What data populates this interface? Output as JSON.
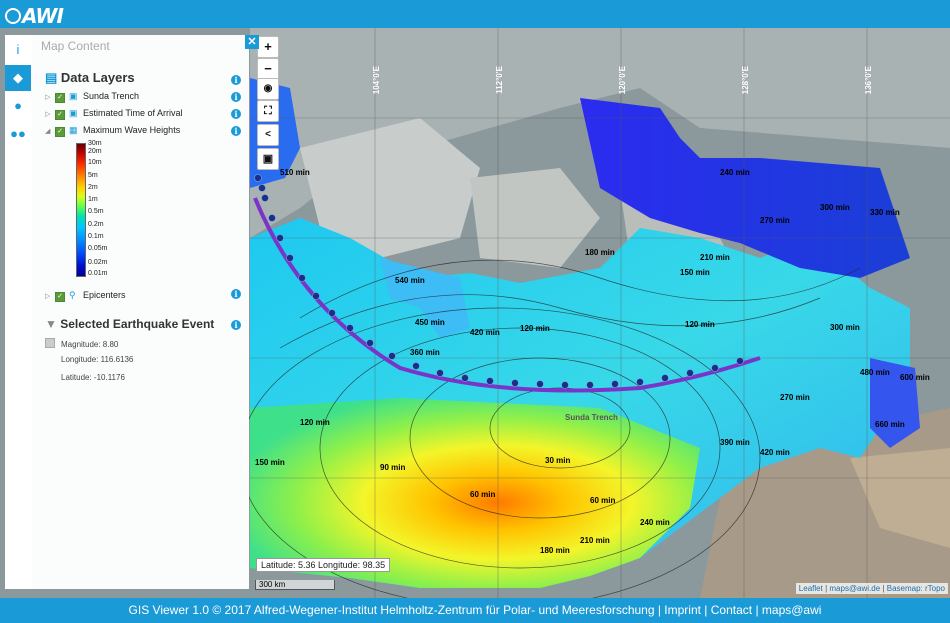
{
  "app": {
    "logo_text": "AWI"
  },
  "panel": {
    "title": "Map Content",
    "data_layers_title": "Data Layers",
    "layers": [
      {
        "label": "Sunda Trench",
        "icon": "image-icon"
      },
      {
        "label": "Estimated Time of Arrival",
        "icon": "image-icon"
      },
      {
        "label": "Maximum Wave Heights",
        "icon": "grid-icon"
      },
      {
        "label": "Epicenters",
        "icon": "marker-icon"
      }
    ],
    "legend": [
      "30m",
      "20m",
      "10m",
      "5m",
      "2m",
      "1m",
      "0.5m",
      "0.2m",
      "0.1m",
      "0.05m",
      "0.02m",
      "0.01m"
    ],
    "event_title": "Selected Earthquake Event",
    "event": {
      "magnitude": "Magnitude: 8.80",
      "longitude": "Longitude: 116.6136",
      "latitude": "Latitude: -10.1176"
    }
  },
  "map": {
    "longitudes": [
      "104°0'E",
      "112°0'E",
      "120°0'E",
      "128°0'E",
      "136°0'E"
    ],
    "coord_readout": "Latitude: 5.36 Longitude: 98.35",
    "scale": "300 km",
    "trench_label": "Sunda Trench",
    "contours": [
      "30 min",
      "60 min",
      "90 min",
      "120 min",
      "150 min",
      "180 min",
      "210 min",
      "240 min",
      "270 min",
      "300 min",
      "330 min",
      "360 min",
      "390 min",
      "420 min",
      "450 min",
      "480 min",
      "510 min",
      "540 min",
      "600 min",
      "660 min"
    ],
    "attribution": {
      "leaflet": "Leaflet",
      "email": "maps@awi.de",
      "basemap": "Basemap: rTopo"
    }
  },
  "footer": {
    "text": "GIS Viewer 1.0 © 2017 Alfred-Wegener-Institut Helmholtz-Zentrum für Polar- und Meeresforschung | Imprint | Contact | maps@awi"
  },
  "colors": {
    "brand": "#1a9ad6"
  }
}
